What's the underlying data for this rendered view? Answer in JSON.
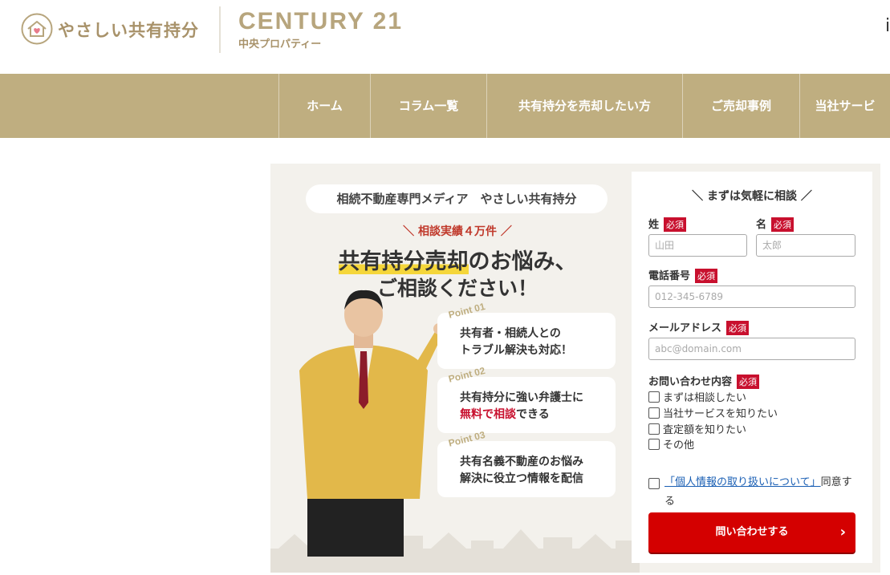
{
  "header": {
    "logo_text": "やさしい共有持分",
    "brand": "CENTURY 21",
    "brand_sub": "中央プロパティー",
    "edge_char": "i"
  },
  "nav": {
    "items": [
      {
        "label": "ホーム"
      },
      {
        "label": "コラム一覧"
      },
      {
        "label": "共有持分を売却したい方"
      },
      {
        "label": "ご売却事例"
      },
      {
        "label": "当社サービ"
      }
    ]
  },
  "banner": {
    "pill": "相続不動産専門メディア　やさしい共有持分",
    "record": "＼ 相談実績４万件 ／",
    "headline_highlight": "共有持分売却",
    "headline_rest": "のお悩み、",
    "headline_line2": "ご相談ください！",
    "points": [
      {
        "label": "Point 01",
        "line1": "共有者・相続人との",
        "line2": "トラブル解決も対応！"
      },
      {
        "label": "Point 02",
        "line1": "共有持分に強い弁護士に",
        "line2_red": "無料で相談",
        "line2_rest": "できる"
      },
      {
        "label": "Point 03",
        "line1": "共有名義不動産のお悩み",
        "line2": "解決に役立つ情報を配信"
      }
    ]
  },
  "form": {
    "title": "＼ まずは気軽に相談 ／",
    "required": "必須",
    "last_name_label": "姓",
    "first_name_label": "名",
    "last_name_placeholder": "山田",
    "first_name_placeholder": "太郎",
    "phone_label": "電話番号",
    "phone_placeholder": "012-345-6789",
    "email_label": "メールアドレス",
    "email_placeholder": "abc@domain.com",
    "inquiry_label": "お問い合わせ内容",
    "options": [
      "まずは相談したい",
      "当社サービスを知りたい",
      "査定額を知りたい",
      "その他"
    ],
    "privacy_link": "「個人情報の取り扱いについて」",
    "privacy_rest": "同意する",
    "submit": "問い合わせする"
  },
  "colors": {
    "nav_bg": "#bfae80",
    "brand_gold": "#b7a57d",
    "required_red": "#c8102e",
    "submit_red": "#d40000"
  }
}
